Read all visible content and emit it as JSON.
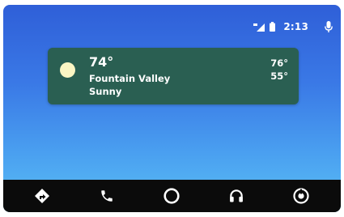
{
  "status_bar": {
    "time": "2:13",
    "icons": [
      "signal-icon",
      "battery-icon",
      "microphone-icon"
    ]
  },
  "weather_card": {
    "icon": "sun-icon",
    "temperature": "74°",
    "location": "Fountain Valley",
    "condition": "Sunny",
    "high": "76°",
    "low": "55°"
  },
  "nav_bar": {
    "items": [
      {
        "name": "navigation",
        "icon": "directions-icon"
      },
      {
        "name": "phone",
        "icon": "phone-icon"
      },
      {
        "name": "home",
        "icon": "circle-home-icon"
      },
      {
        "name": "audio",
        "icon": "headphones-icon"
      },
      {
        "name": "exit",
        "icon": "car-exit-icon"
      }
    ]
  },
  "colors": {
    "background_top": "#2f5fd8",
    "background_bottom": "#5bc0f6",
    "card": "#2a5f52",
    "nav_bar": "#0b0b0b",
    "foreground": "#ffffff"
  }
}
